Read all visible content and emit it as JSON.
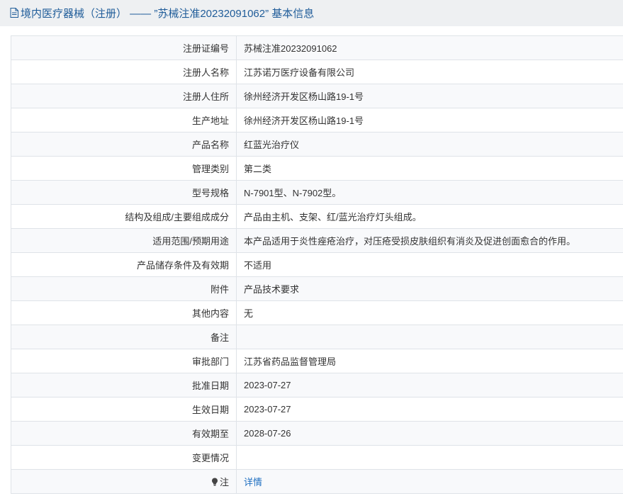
{
  "header": {
    "title": "境内医疗器械（注册） —— ”苏械注准20232091062” 基本信息"
  },
  "rows": [
    {
      "label": "注册证编号",
      "value": "苏械注准20232091062"
    },
    {
      "label": "注册人名称",
      "value": "江苏诺万医疗设备有限公司"
    },
    {
      "label": "注册人住所",
      "value": "徐州经济开发区杨山路19-1号"
    },
    {
      "label": "生产地址",
      "value": "徐州经济开发区杨山路19-1号"
    },
    {
      "label": "产品名称",
      "value": "红蓝光治疗仪"
    },
    {
      "label": "管理类别",
      "value": "第二类"
    },
    {
      "label": "型号规格",
      "value": "N-7901型、N-7902型。"
    },
    {
      "label": "结构及组成/主要组成成分",
      "value": "产品由主机、支架、红/蓝光治疗灯头组成。"
    },
    {
      "label": "适用范围/预期用途",
      "value": "本产品适用于炎性痤疮治疗，对压疮受损皮肤组织有消炎及促进创面愈合的作用。"
    },
    {
      "label": "产品储存条件及有效期",
      "value": "不适用"
    },
    {
      "label": "附件",
      "value": "产品技术要求"
    },
    {
      "label": "其他内容",
      "value": "无"
    },
    {
      "label": "备注",
      "value": ""
    },
    {
      "label": "审批部门",
      "value": "江苏省药品监督管理局"
    },
    {
      "label": "批准日期",
      "value": "2023-07-27"
    },
    {
      "label": "生效日期",
      "value": "2023-07-27"
    },
    {
      "label": "有效期至",
      "value": "2028-07-26"
    },
    {
      "label": "变更情况",
      "value": ""
    }
  ],
  "note_row": {
    "label": "注",
    "link": "详情",
    "icon": "lightbulb-icon"
  },
  "colors": {
    "accent": "#1f5c99",
    "link": "#1f6fc1",
    "header_bg": "#eef0f2",
    "border": "#dfe3e8"
  }
}
